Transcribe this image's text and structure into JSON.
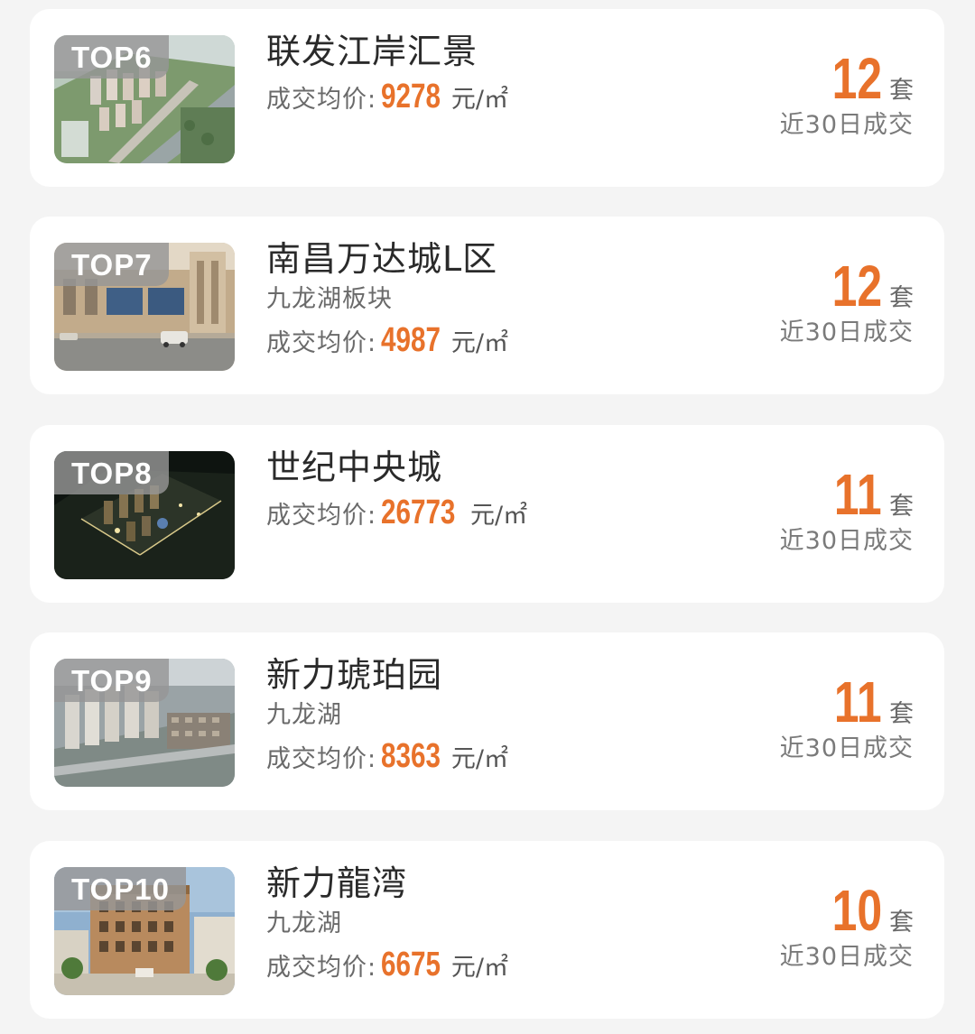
{
  "listings": [
    {
      "rank": "TOP6",
      "name": "联发江岸汇景",
      "area": "",
      "price_label": "成交均价:",
      "price": "9278",
      "price_unit": "元/㎡",
      "count": "12",
      "count_unit": "套",
      "period": "近30日成交",
      "image": "aerial-residential-day"
    },
    {
      "rank": "TOP7",
      "name": "南昌万达城L区",
      "area": "九龙湖板块",
      "price_label": "成交均价:",
      "price": "4987",
      "price_unit": "元/㎡",
      "count": "12",
      "count_unit": "套",
      "period": "近30日成交",
      "image": "street-building-facade"
    },
    {
      "rank": "TOP8",
      "name": "世纪中央城",
      "area": "",
      "price_label": "成交均价:",
      "price": "26773",
      "price_unit": "元/㎡",
      "count": "11",
      "count_unit": "套",
      "period": "近30日成交",
      "image": "aerial-night-complex"
    },
    {
      "rank": "TOP9",
      "name": "新力琥珀园",
      "area": "九龙湖",
      "price_label": "成交均价:",
      "price": "8363",
      "price_unit": "元/㎡",
      "count": "11",
      "count_unit": "套",
      "period": "近30日成交",
      "image": "aerial-residential-grey"
    },
    {
      "rank": "TOP10",
      "name": "新力龍湾",
      "area": "九龙湖",
      "price_label": "成交均价:",
      "price": "6675",
      "price_unit": "元/㎡",
      "count": "10",
      "count_unit": "套",
      "period": "近30日成交",
      "image": "apartment-tower-courtyard"
    }
  ],
  "colors": {
    "accent": "#e8722b",
    "card": "#ffffff",
    "background": "#f4f4f4",
    "badge": "#969696"
  }
}
